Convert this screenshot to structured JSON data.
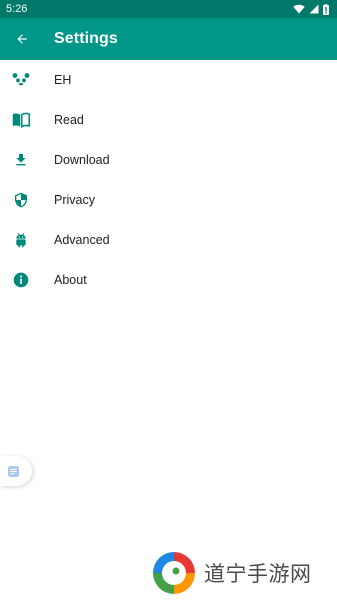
{
  "status_bar": {
    "time": "5:26",
    "icons": [
      "wifi-icon",
      "cell-signal-icon",
      "battery-icon"
    ]
  },
  "toolbar": {
    "title": "Settings",
    "back_icon": "arrow-back-icon"
  },
  "colors": {
    "status_bar": "#00796b",
    "toolbar": "#009688",
    "accent_icon": "#00897b",
    "text_primary": "#212121"
  },
  "settings": {
    "items": [
      {
        "label": "EH",
        "icon": "panda-icon"
      },
      {
        "label": "Read",
        "icon": "book-icon"
      },
      {
        "label": "Download",
        "icon": "download-icon"
      },
      {
        "label": "Privacy",
        "icon": "shield-icon"
      },
      {
        "label": "Advanced",
        "icon": "android-icon"
      },
      {
        "label": "About",
        "icon": "info-icon"
      }
    ]
  },
  "floating_button": {
    "icon": "note-icon"
  },
  "watermark": {
    "text": "道宁手游网",
    "icon": "swirl-logo-icon"
  }
}
